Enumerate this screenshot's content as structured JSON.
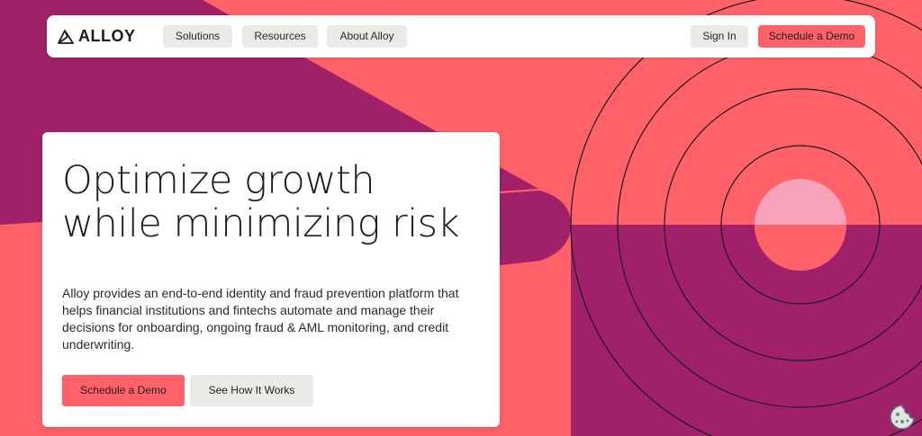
{
  "brand": {
    "logo_text": "ALLOY",
    "colors": {
      "coral": "#fe6168",
      "magenta": "#a0206a",
      "pink": "#f8a3b9",
      "light_button": "#ebebe5"
    }
  },
  "nav": {
    "items": [
      {
        "label": "Solutions"
      },
      {
        "label": "Resources"
      },
      {
        "label": "About Alloy"
      }
    ],
    "sign_in": "Sign In",
    "schedule_demo": "Schedule a Demo"
  },
  "hero": {
    "headline": "Optimize growth while minimizing risk",
    "description": "Alloy provides an end-to-end identity and fraud prevention platform that helps financial institutions and fintechs automate and manage their decisions for onboarding, ongoing fraud & AML monitoring, and credit underwriting.",
    "primary_cta": "Schedule a Demo",
    "secondary_cta": "See How It Works"
  },
  "icons": {
    "logo": "alloy-logo-icon",
    "cookie": "cookie-icon"
  }
}
